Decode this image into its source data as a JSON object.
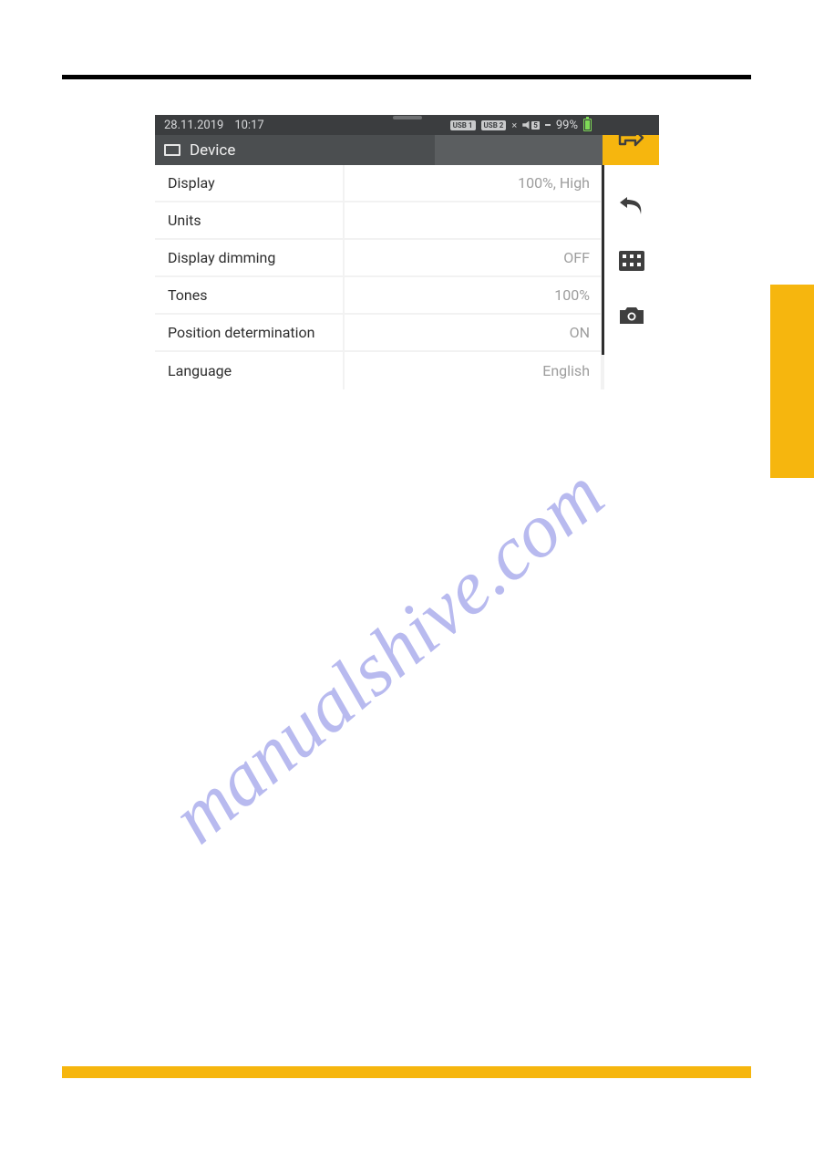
{
  "status": {
    "date": "28.11.2019",
    "time": "10:17",
    "usb1": "USB 1",
    "usb2": "USB 2",
    "vol_level": "5",
    "battery_pct": "99%"
  },
  "title": {
    "label": "Device"
  },
  "rows": [
    {
      "label": "Display",
      "value": "100%, High"
    },
    {
      "label": "Units",
      "value": ""
    },
    {
      "label": "Display dimming",
      "value": "OFF"
    },
    {
      "label": "Tones",
      "value": "100%"
    },
    {
      "label": "Position determination",
      "value": "ON"
    },
    {
      "label": "Language",
      "value": "English"
    }
  ],
  "watermark": "manualshive.com"
}
